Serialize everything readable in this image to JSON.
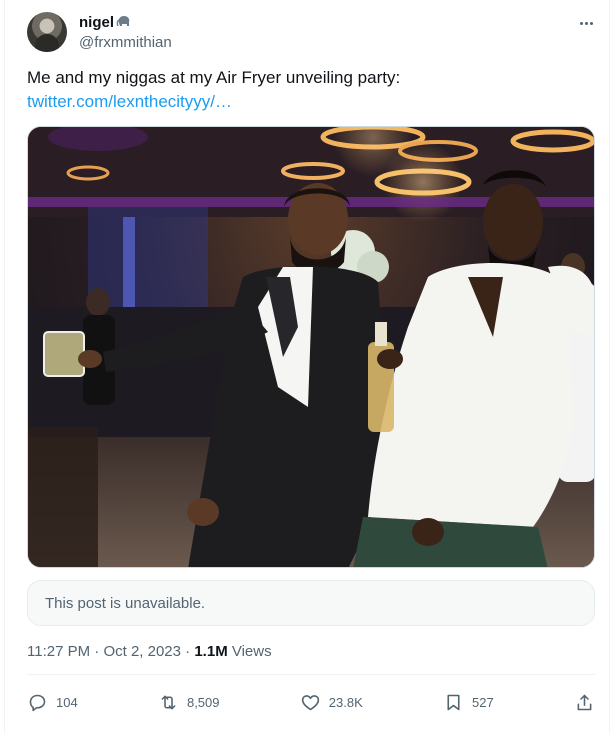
{
  "author": {
    "display_name": "nigel",
    "badge_icon": "elephant-icon",
    "handle": "@frxmmithian"
  },
  "tweet": {
    "text": "Me and my niggas at my Air Fryer unveiling party:",
    "link": "twitter.com/lexnthecityyy/…"
  },
  "quoted_post": {
    "unavailable_text": "This post is unavailable."
  },
  "meta": {
    "time": "11:27 PM",
    "separator": " · ",
    "date": "Oct 2, 2023",
    "separator2": " · ",
    "views_count": "1.1M",
    "views_label": " Views"
  },
  "actions": {
    "replies": "104",
    "reposts": "8,509",
    "likes": "23.8K",
    "bookmarks": "527"
  },
  "colors": {
    "link": "#1d9bf0",
    "secondary_text": "#536471"
  }
}
